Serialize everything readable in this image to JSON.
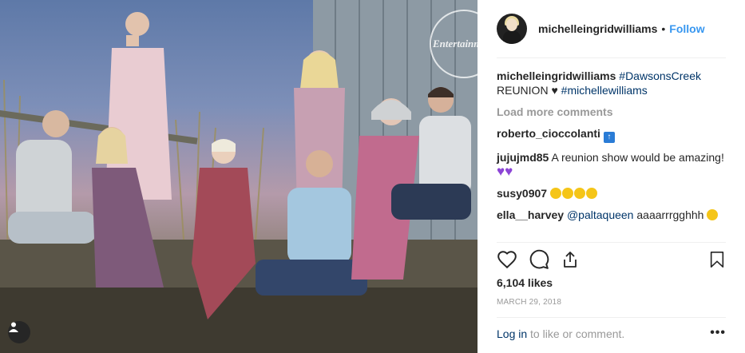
{
  "header": {
    "username": "michelleingridwilliams",
    "separator": "•",
    "follow_label": "Follow"
  },
  "caption": {
    "username": "michelleingridwilliams",
    "hashtag1": "#DawsonsCreek",
    "text": "REUNION ♥",
    "hashtag2": "#michellewilliams"
  },
  "load_more_label": "Load more comments",
  "comments": [
    {
      "username": "roberto_cioccolanti",
      "text": "",
      "emoji": "top-arrow"
    },
    {
      "username": "jujujmd85",
      "text": "A reunion show would be amazing!",
      "emoji": "purple-hearts"
    },
    {
      "username": "susy0907",
      "text": "",
      "emoji": "star-eyes"
    },
    {
      "username": "ella__harvey",
      "mention": "@paltaqueen",
      "text": "aaaarrrgghhh",
      "emoji": "scream"
    }
  ],
  "stamp_text": "Entertainment",
  "likes": "6,104 likes",
  "date": "MARCH 29, 2018",
  "footer": {
    "login_label": "Log in",
    "rest": "to like or comment.",
    "more": "•••"
  },
  "colors": {
    "link": "#003569",
    "follow": "#3897f0",
    "muted": "#999999"
  },
  "icons": [
    "heart-icon",
    "comment-icon",
    "share-icon",
    "bookmark-icon",
    "user-tag-icon",
    "more-options-icon"
  ]
}
